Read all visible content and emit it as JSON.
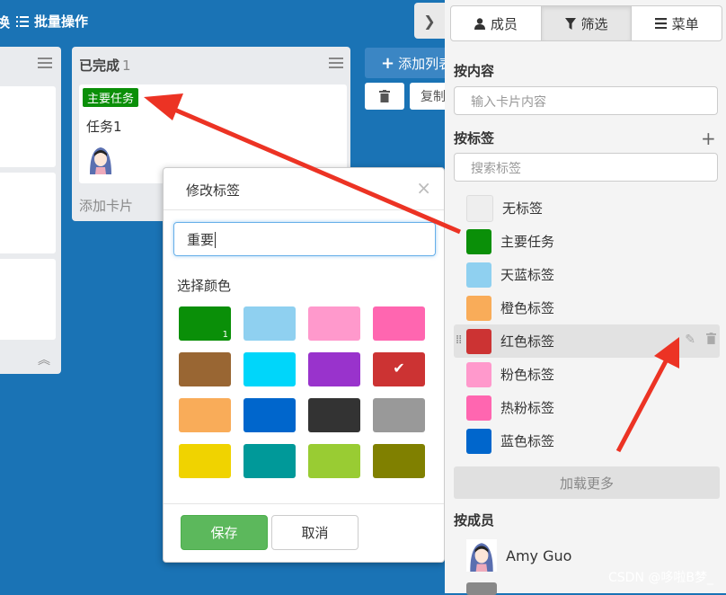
{
  "topbar": {
    "cut_text": "换",
    "batch_label": "批量操作"
  },
  "board": {
    "done_column": {
      "title": "已完成",
      "count": "1",
      "card": {
        "tag": "主要任务",
        "title": "任务1"
      },
      "add_card": "添加卡片"
    },
    "add_list": "添加列表",
    "copy": "复制"
  },
  "popup": {
    "title": "修改标签",
    "name_value": "重要",
    "color_label": "选择颜色",
    "colors": [
      "#0a8f08",
      "#8fd0f0",
      "#ff99cc",
      "#ff66b0",
      "#996633",
      "#00d6fa",
      "#9933cc",
      "#cc3333",
      "#f9ac59",
      "#0066cc",
      "#333333",
      "#999999",
      "#f0d300",
      "#009999",
      "#99cc33",
      "#808000"
    ],
    "selected_count": "1",
    "save": "保存",
    "cancel": "取消"
  },
  "panel": {
    "tabs": [
      "成员",
      "筛选",
      "菜单"
    ],
    "by_content": "按内容",
    "content_placeholder": "输入卡片内容",
    "by_label": "按标签",
    "label_placeholder": "搜索标签",
    "labels": [
      {
        "name": "无标签",
        "color": "#eeeeee"
      },
      {
        "name": "主要任务",
        "color": "#0a8f08"
      },
      {
        "name": "天蓝标签",
        "color": "#8fd0f0"
      },
      {
        "name": "橙色标签",
        "color": "#f9ac59"
      },
      {
        "name": "红色标签",
        "color": "#cc3333"
      },
      {
        "name": "粉色标签",
        "color": "#ff99cc"
      },
      {
        "name": "热粉标签",
        "color": "#ff66b0"
      },
      {
        "name": "蓝色标签",
        "color": "#0066cc"
      }
    ],
    "load_more": "加载更多",
    "by_member": "按成员",
    "member_name": "Amy Guo"
  },
  "watermark": "CSDN @哆啦B梦_"
}
